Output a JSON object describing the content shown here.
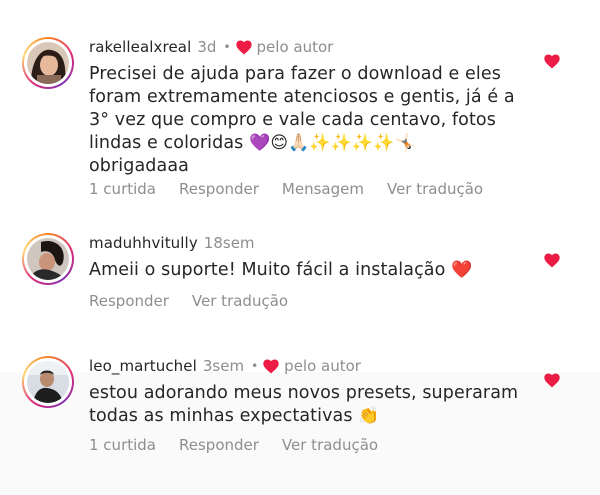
{
  "colors": {
    "heart": "#ed1c45",
    "text": "#262626",
    "muted": "#8e8e8e"
  },
  "comments": [
    {
      "username": "rakellealxreal",
      "time": "3d",
      "author_label": "pelo autor",
      "liked_by_author": true,
      "text_main": "Precisei de ajuda para fazer o download e eles foram extremamente atenciosos e gentis, já é a 3° vez que compro e vale cada centavo, fotos lindas e coloridas",
      "text_emojis": "💜😊🙏🏻✨✨✨✨🤸🏻",
      "text_end": "obrigadaaa",
      "actions": {
        "likes": "1 curtida",
        "reply": "Responder",
        "message": "Mensagem",
        "translate": "Ver tradução"
      },
      "liked": true
    },
    {
      "username": "maduhhvitully",
      "time": "18sem",
      "text_main": "Ameii o suporte! Muito fácil a instalação",
      "text_emojis": "❤️",
      "actions": {
        "reply": "Responder",
        "translate": "Ver tradução"
      },
      "liked": true
    },
    {
      "username": "leo_martuchel",
      "time": "3sem",
      "author_label": "pelo autor",
      "liked_by_author": true,
      "text_main": "estou adorando meus novos presets, superaram todas as minhas expectativas",
      "text_emojis": "👏",
      "actions": {
        "likes": "1 curtida",
        "reply": "Responder",
        "translate": "Ver tradução"
      },
      "liked": true
    }
  ]
}
